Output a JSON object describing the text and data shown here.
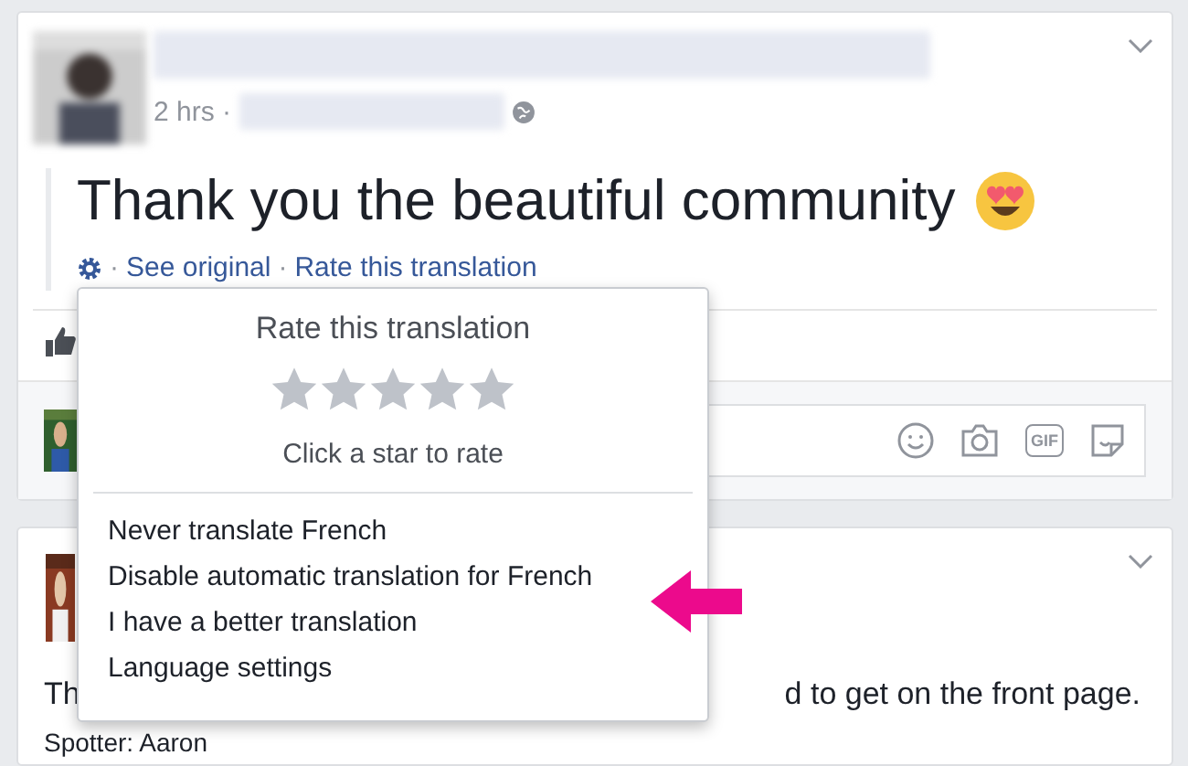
{
  "post": {
    "time": "2 hrs ·",
    "text": "Thank you the beautiful community",
    "translation_links": [
      {
        "separator": "·",
        "label": "See original"
      },
      {
        "separator": "·",
        "label": "Rate this translation"
      }
    ]
  },
  "comment_box": {
    "gif_label": "GIF"
  },
  "rating_menu": {
    "title": "Rate this translation",
    "stars": 0,
    "hint": "Click a star to rate",
    "items": [
      {
        "label": "Never translate French"
      },
      {
        "label": "Disable automatic translation for French"
      },
      {
        "label": "I have a better translation"
      },
      {
        "label": "Language settings"
      }
    ]
  },
  "second_post": {
    "text_start": "Th",
    "text_end": "d to get on the front page.",
    "spotter": "Spotter: Aaron"
  }
}
